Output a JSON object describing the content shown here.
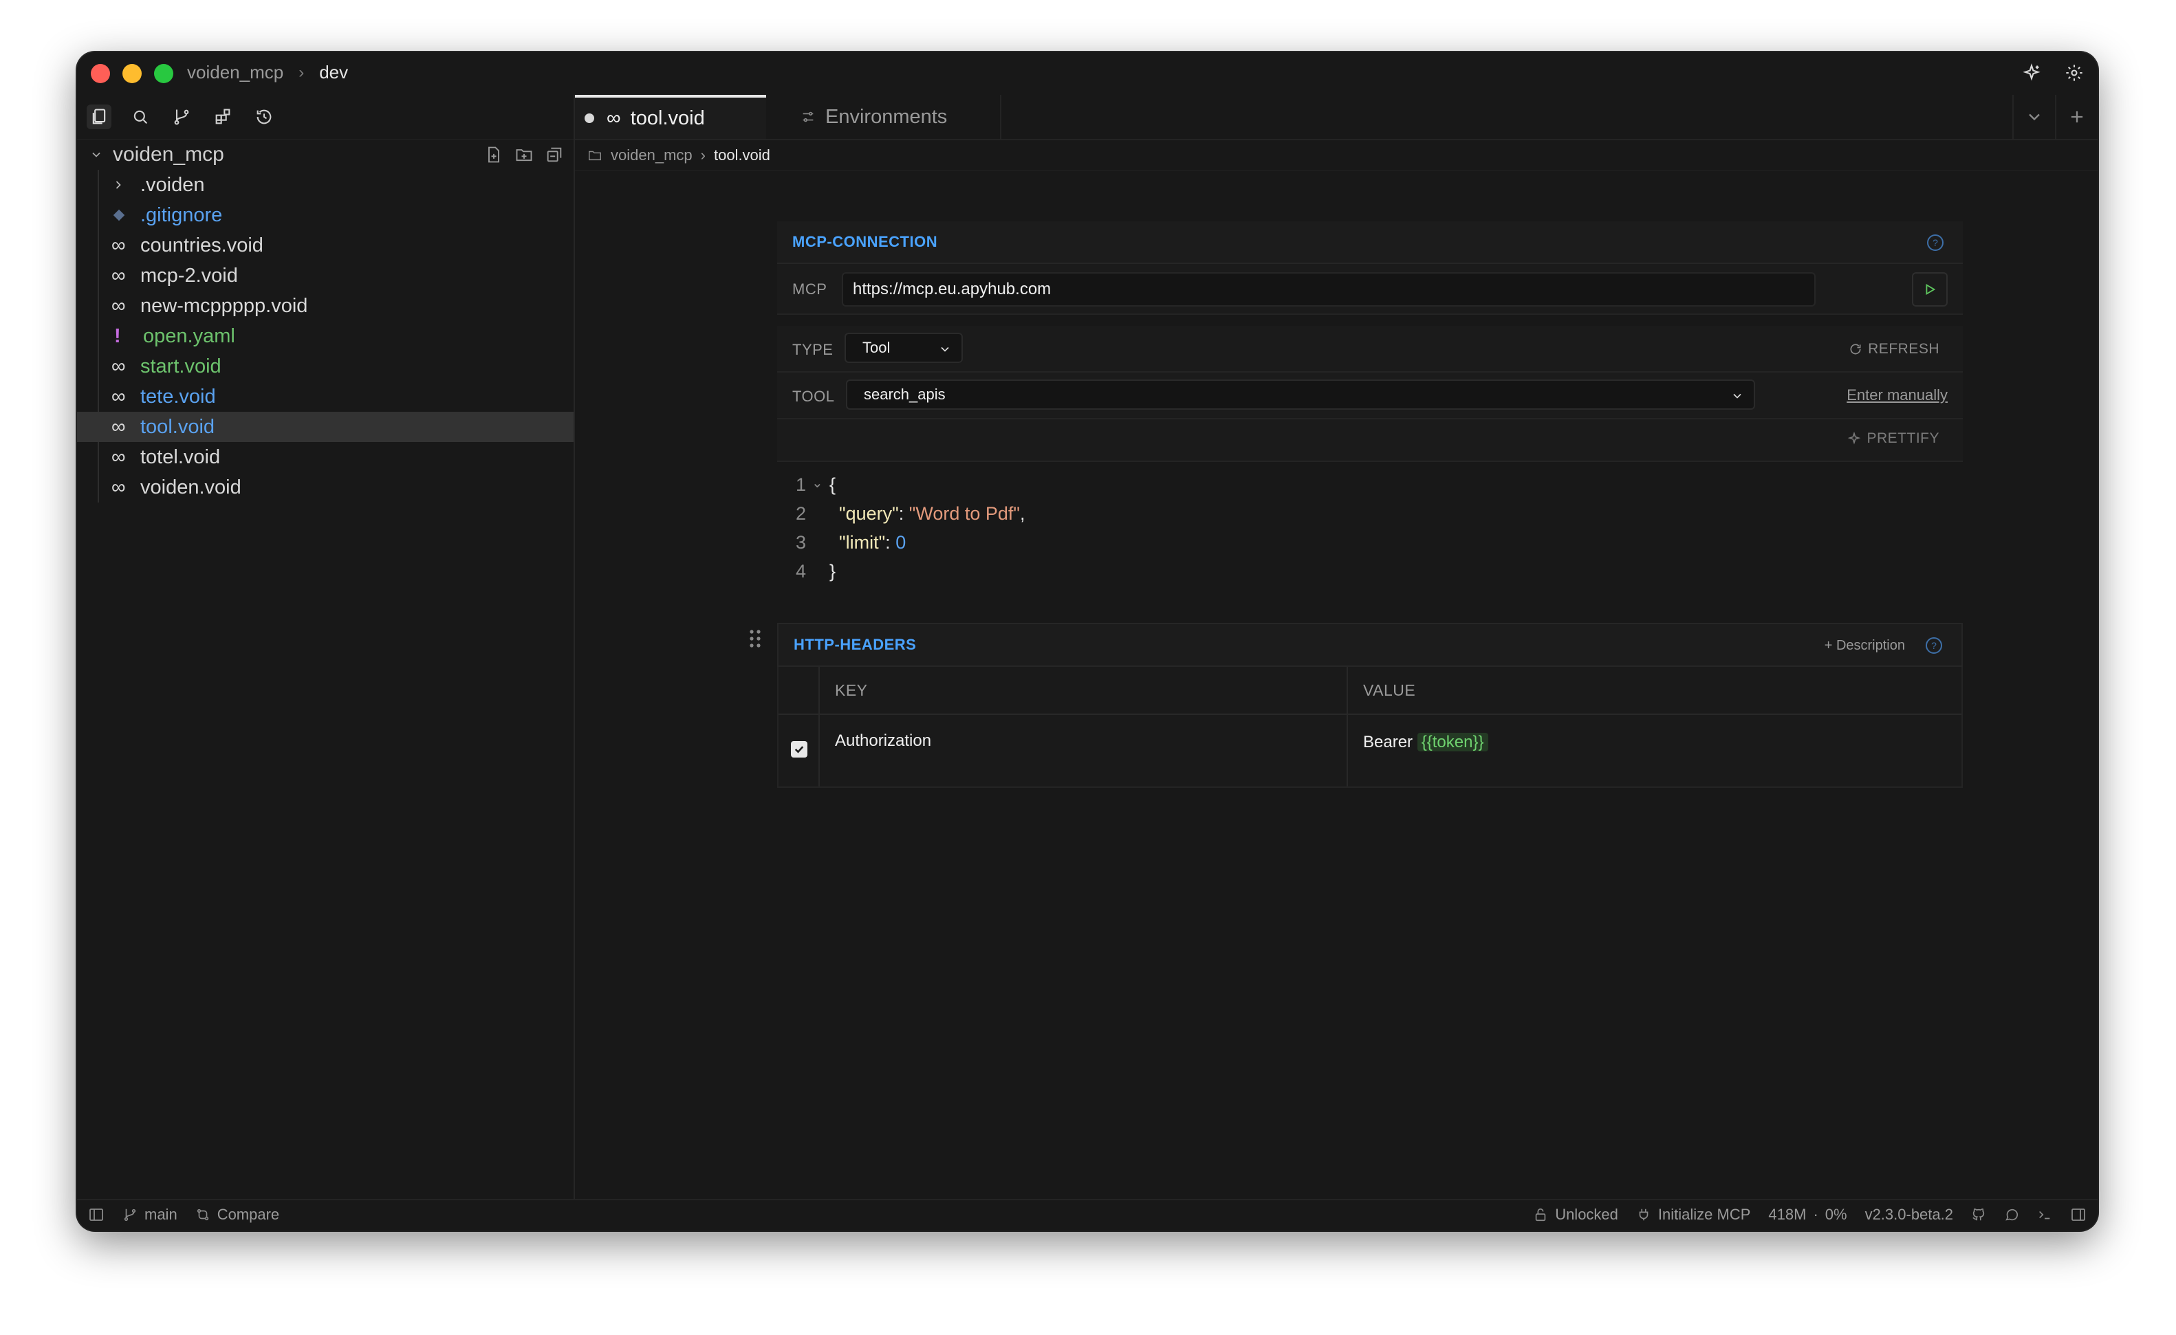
{
  "titlebar": {
    "project": "voiden_mcp",
    "branch": "dev"
  },
  "sidebar": {
    "root_label": "voiden_mcp",
    "items": [
      {
        "label": ".voiden",
        "kind": "folder",
        "color": "default"
      },
      {
        "label": ".gitignore",
        "kind": "git",
        "color": "blue"
      },
      {
        "label": "countries.void",
        "kind": "void",
        "color": "default"
      },
      {
        "label": "mcp-2.void",
        "kind": "void",
        "color": "default"
      },
      {
        "label": "new-mcppppp.void",
        "kind": "void",
        "color": "default"
      },
      {
        "label": "open.yaml",
        "kind": "yaml",
        "color": "green"
      },
      {
        "label": "start.void",
        "kind": "void",
        "color": "green"
      },
      {
        "label": "tete.void",
        "kind": "void",
        "color": "blue"
      },
      {
        "label": "tool.void",
        "kind": "void",
        "color": "blue",
        "selected": true
      },
      {
        "label": "totel.void",
        "kind": "void",
        "color": "default"
      },
      {
        "label": "voiden.void",
        "kind": "void",
        "color": "default"
      }
    ]
  },
  "tabs": {
    "active": "tool.void",
    "environments": "Environments"
  },
  "path": {
    "folder": "voiden_mcp",
    "file": "tool.void"
  },
  "mcp_connection": {
    "title": "MCP-CONNECTION",
    "help": "?",
    "mcp_label": "MCP",
    "url": "https://mcp.eu.apyhub.com",
    "type_label": "TYPE",
    "type_value": "Tool",
    "refresh": "REFRESH",
    "tool_label": "TOOL",
    "tool_value": "search_apis",
    "enter_manually": "Enter manually",
    "prettify": "PRETTIFY"
  },
  "code": {
    "lines": [
      "1",
      "2",
      "3",
      "4"
    ],
    "open_brace": "{",
    "close_brace": "}",
    "key1": "\"query\"",
    "val1": "\"Word to Pdf\"",
    "key2": "\"limit\"",
    "val2": "0",
    "colon": ": ",
    "comma": ","
  },
  "http_headers": {
    "title": "HTTP-HEADERS",
    "add_description": "+ Description",
    "help": "?",
    "col_key": "KEY",
    "col_value": "VALUE",
    "rows": [
      {
        "enabled": true,
        "key": "Authorization",
        "value_prefix": "Bearer",
        "value_var": "{{token}}"
      }
    ]
  },
  "statusbar": {
    "branch": "main",
    "compare": "Compare",
    "lock": "Unlocked",
    "init_mcp": "Initialize MCP",
    "memory": "418M",
    "sep": "·",
    "cpu": "0%",
    "version": "v2.3.0-beta.2"
  }
}
